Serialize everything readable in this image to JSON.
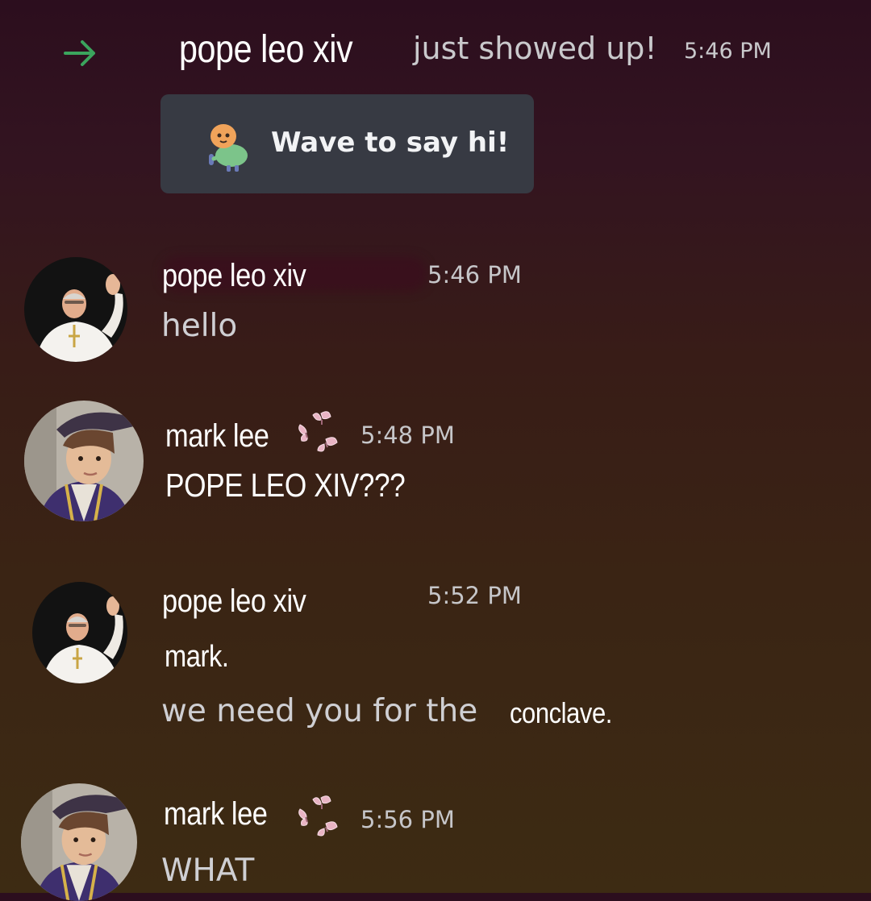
{
  "system_message": {
    "icon": "arrow-right-icon",
    "username": "pope leo xiv",
    "text": "just showed up!",
    "timestamp": "5:46 PM",
    "wave_button_label": "Wave to say hi!",
    "colors": {
      "arrow": "#3ba55d",
      "button_bg": "#373a43"
    }
  },
  "messages": [
    {
      "author": "pope leo xiv",
      "avatar": "pope-avatar",
      "timestamp": "5:46 PM",
      "lines": [
        "hello"
      ]
    },
    {
      "author": "mark lee",
      "avatar": "mark-lee-avatar",
      "badge": "butterfly-icon",
      "timestamp": "5:48 PM",
      "lines": [
        "POPE LEO XIV???"
      ]
    },
    {
      "author": "pope leo xiv",
      "avatar": "pope-avatar",
      "timestamp": "5:52 PM",
      "lines": [
        "mark.",
        "we need you for the",
        "conclave."
      ]
    },
    {
      "author": "mark lee",
      "avatar": "mark-lee-avatar",
      "badge": "butterfly-icon",
      "timestamp": "5:56 PM",
      "lines": [
        "WHAT"
      ]
    }
  ]
}
